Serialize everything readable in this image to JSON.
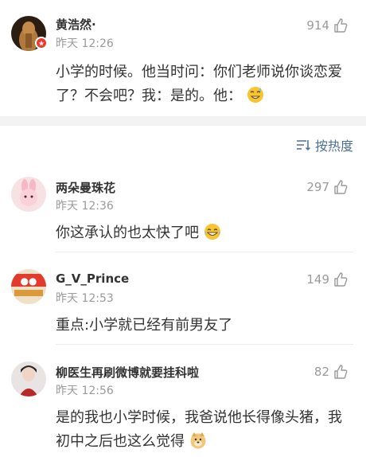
{
  "post": {
    "author": "黄浩然·",
    "time": "昨天 12:26",
    "likes": "914",
    "text": "小学的时候。他当时问：你们老师说你谈恋爱了？不会吧？我：是的。他："
  },
  "sort": {
    "label": "按热度",
    "icon": "sort-icon"
  },
  "replies": [
    {
      "author": "两朵曼珠花",
      "time": "昨天 12:36",
      "likes": "297",
      "text": "你这承认的也太快了吧",
      "emoji": "laugh-cry"
    },
    {
      "author": "G_V_Prince",
      "time": "昨天 12:53",
      "likes": "149",
      "text": "重点:小学就已经有前男友了"
    },
    {
      "author": "柳医生再刷微博就要挂科啦",
      "time": "昨天 12:56",
      "likes": "82",
      "text": "是的我也小学时候，我爸说他长得像头猪，我初中之后也这么觉得",
      "emoji": "doge"
    }
  ],
  "colors": {
    "accent": "#4a6f9a",
    "muted": "#9a9a9a",
    "badge": "#e83a2f"
  }
}
